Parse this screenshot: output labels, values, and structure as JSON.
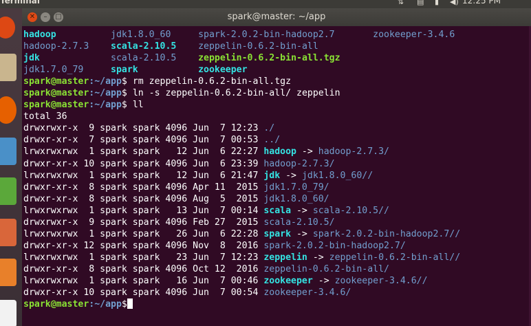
{
  "top_panel": {
    "app_name": "Terminal",
    "clock": "12:25 PM"
  },
  "window": {
    "title": "spark@master: ~/app"
  },
  "colors": {
    "terminal_bg": "#300a24",
    "prompt": "#8ae234",
    "path": "#729fcf",
    "symlink": "#34e2e2",
    "close": "#df4a16"
  },
  "terminal": {
    "ls_grid": [
      [
        "hadoop",
        "jdk1.8.0_60",
        "spark-2.0.2-bin-hadoop2.7",
        "zookeeper-3.4.6"
      ],
      [
        "hadoop-2.7.3",
        "scala-2.10.5",
        "zeppelin-0.6.2-bin-all",
        ""
      ],
      [
        "jdk",
        "scala-2.10.5",
        "zeppelin-0.6.2-bin-all.tgz",
        ""
      ],
      [
        "jdk1.7.0_79",
        "spark",
        "zookeeper",
        ""
      ]
    ],
    "prompt_user": "spark@master",
    "prompt_path": ":~/app",
    "prompt_sign": "$",
    "cmd1": " rm zeppelin-0.6.2-bin-all.tgz",
    "cmd2": " ln -s zeppelin-0.6.2-bin-all/ zeppelin",
    "cmd3": " ll",
    "total": "total 36",
    "ll_rows": [
      {
        "meta": "drwxrwxr-x  9 spark spark 4096 Jun  7 12:23 ",
        "name": "./",
        "arrow": "",
        "target": ""
      },
      {
        "meta": "drwxr-xr-x  7 spark spark 4096 Jun  7 00:53 ",
        "name": "../",
        "arrow": "",
        "target": ""
      },
      {
        "meta": "lrwxrwxrwx  1 spark spark   12 Jun  6 22:27 ",
        "name": "hadoop",
        "arrow": " -> ",
        "target": "hadoop-2.7.3/"
      },
      {
        "meta": "drwxr-xr-x 10 spark spark 4096 Jun  6 23:39 ",
        "name": "hadoop-2.7.3/",
        "arrow": "",
        "target": ""
      },
      {
        "meta": "lrwxrwxrwx  1 spark spark   12 Jun  6 21:47 ",
        "name": "jdk",
        "arrow": " -> ",
        "target": "jdk1.8.0_60//"
      },
      {
        "meta": "drwxr-xr-x  8 spark spark 4096 Apr 11  2015 ",
        "name": "jdk1.7.0_79/",
        "arrow": "",
        "target": ""
      },
      {
        "meta": "drwxr-xr-x  8 spark spark 4096 Aug  5  2015 ",
        "name": "jdk1.8.0_60/",
        "arrow": "",
        "target": ""
      },
      {
        "meta": "lrwxrwxrwx  1 spark spark   13 Jun  7 00:14 ",
        "name": "scala",
        "arrow": " -> ",
        "target": "scala-2.10.5//"
      },
      {
        "meta": "drwxrwxr-x  9 spark spark 4096 Feb 27  2015 ",
        "name": "scala-2.10.5/",
        "arrow": "",
        "target": ""
      },
      {
        "meta": "lrwxrwxrwx  1 spark spark   26 Jun  6 22:28 ",
        "name": "spark",
        "arrow": " -> ",
        "target": "spark-2.0.2-bin-hadoop2.7//"
      },
      {
        "meta": "drwxr-xr-x 12 spark spark 4096 Nov  8  2016 ",
        "name": "spark-2.0.2-bin-hadoop2.7/",
        "arrow": "",
        "target": ""
      },
      {
        "meta": "lrwxrwxrwx  1 spark spark   23 Jun  7 12:23 ",
        "name": "zeppelin",
        "arrow": " -> ",
        "target": "zeppelin-0.6.2-bin-all//"
      },
      {
        "meta": "drwxr-xr-x  8 spark spark 4096 Oct 12  2016 ",
        "name": "zeppelin-0.6.2-bin-all/",
        "arrow": "",
        "target": ""
      },
      {
        "meta": "lrwxrwxrwx  1 spark spark   16 Jun  7 00:46 ",
        "name": "zookeeper",
        "arrow": " -> ",
        "target": "zookeeper-3.4.6//"
      },
      {
        "meta": "drwxr-xr-x 10 spark spark 4096 Jun  7 00:54 ",
        "name": "zookeeper-3.4.6/",
        "arrow": "",
        "target": ""
      }
    ]
  }
}
